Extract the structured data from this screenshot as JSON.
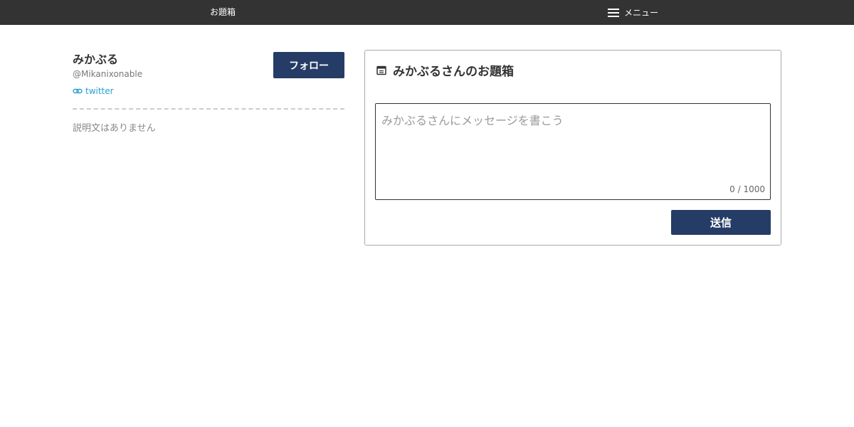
{
  "header": {
    "brand": "お題箱",
    "menu_label": "メニュー",
    "menu_icon": "hamburger-icon"
  },
  "profile": {
    "name": "みかぶる",
    "handle": "@Mikanixonable",
    "link_label": "twitter",
    "link_icon": "link-icon",
    "follow_label": "フォロー",
    "description": "説明文はありません"
  },
  "box": {
    "icon": "inbox-icon",
    "title": "みかぶるさんのお題箱",
    "placeholder": "みかぶるさんにメッセージを書こう",
    "value": "",
    "char_count": "0 / 1000",
    "send_label": "送信"
  },
  "colors": {
    "topbar": "#333333",
    "button": "#253c66",
    "link": "#2a9fd6"
  }
}
